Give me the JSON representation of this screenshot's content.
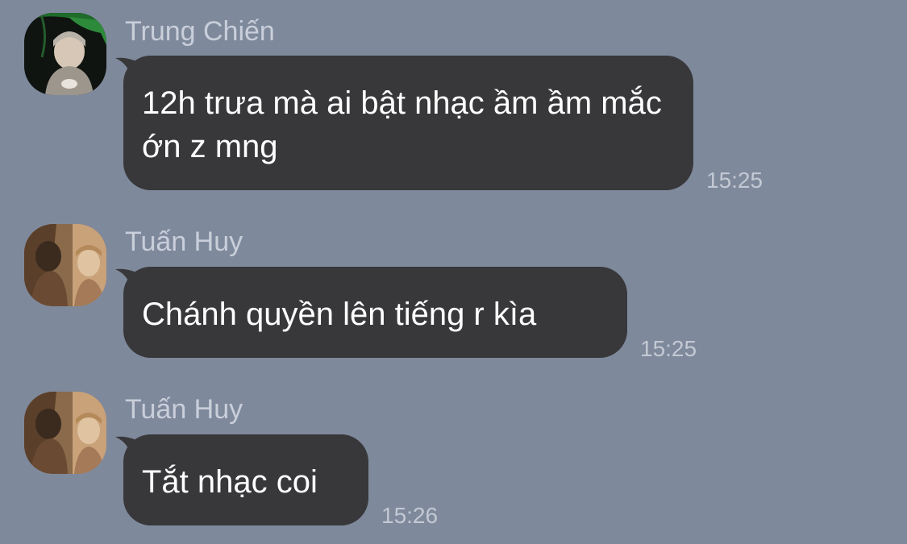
{
  "messages": [
    {
      "sender": "Trung Chiến",
      "avatar_icon": "user-avatar-green-leaf",
      "text": "12h trưa mà ai bật nhạc ầm ầm mắc ớn z mng",
      "time": "15:25"
    },
    {
      "sender": "Tuấn Huy",
      "avatar_icon": "user-avatar-warm-photo",
      "text": "Chánh quyền lên tiếng r kìa",
      "time": "15:25"
    },
    {
      "sender": "Tuấn Huy",
      "avatar_icon": "user-avatar-warm-photo",
      "text": "Tắt nhạc coi",
      "time": "15:26"
    }
  ],
  "colors": {
    "background": "#7f899c",
    "bubble": "#38383a",
    "bubble_text": "#ffffff",
    "sender_text": "#c9cfda",
    "time_text": "#c3c9d3"
  }
}
